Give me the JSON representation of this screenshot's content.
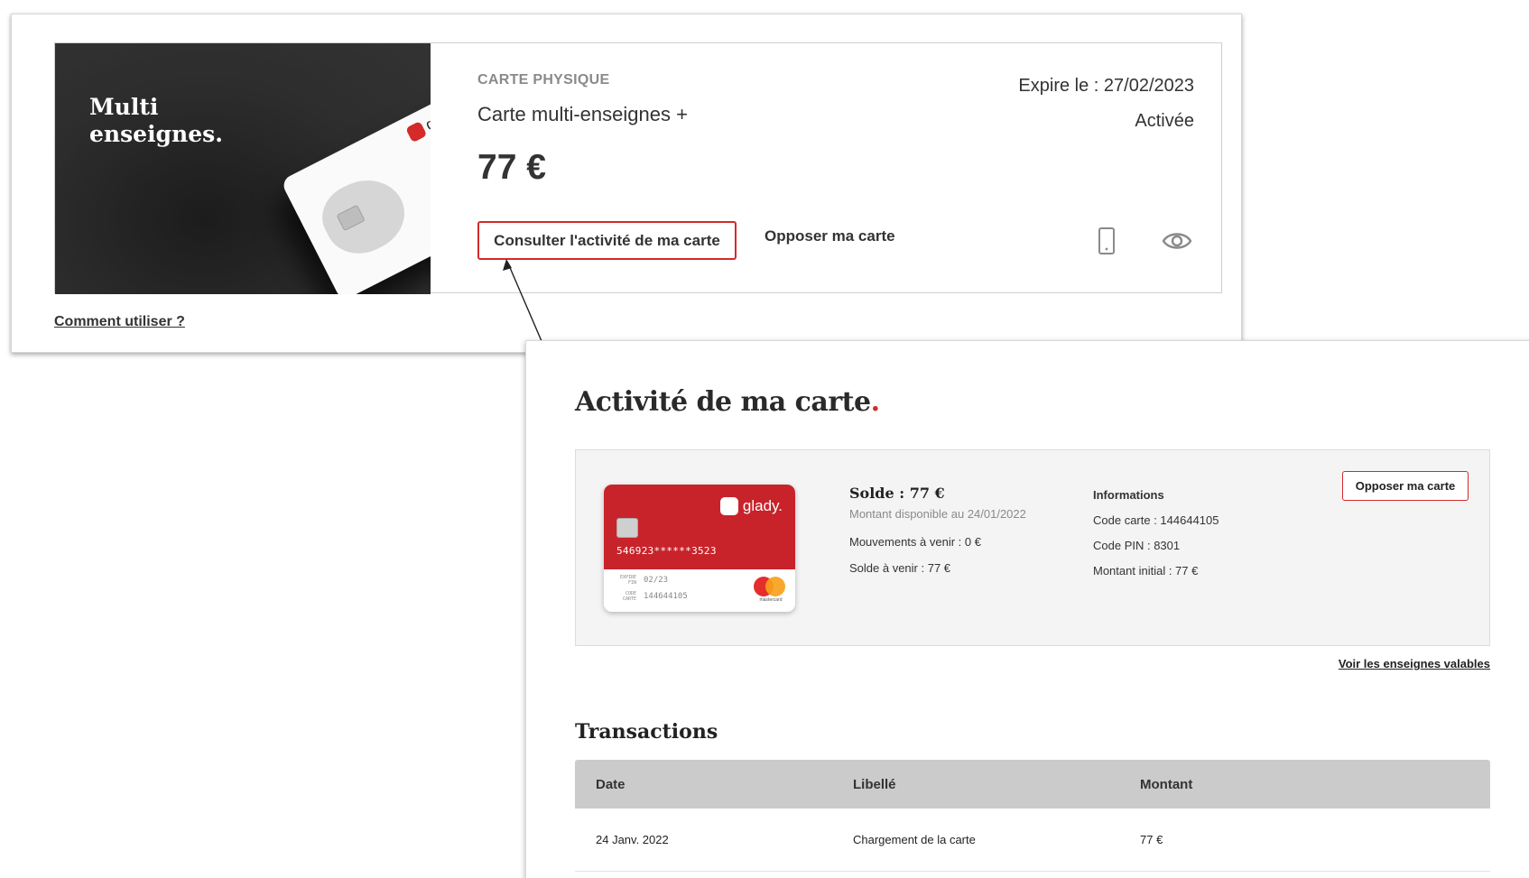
{
  "card_overview": {
    "promo_title_line1": "Multi",
    "promo_title_line2": "enseignes.",
    "promo_logo": "glady.",
    "card_type": "CARTE PHYSIQUE",
    "card_name": "Carte multi-enseignes +",
    "amount": "77 €",
    "expire": "Expire le : 27/02/2023",
    "status": "Activée",
    "activity_button": "Consulter l'activité de ma carte",
    "oppose_button": "Opposer ma carte",
    "icons": [
      "phone-icon",
      "eye-icon"
    ],
    "howto_link": "Comment utiliser ?"
  },
  "activity": {
    "title": "Activité de ma carte",
    "title_dot": ".",
    "virtual_card": {
      "logo": "glady.",
      "number": "546923******3523",
      "expire_label": "EXPIRE FIN",
      "expire_value": "02/23",
      "code_label": "CODE CARTE",
      "code_value": "144644105",
      "network": "mastercard"
    },
    "balance": {
      "title": "Solde : 77 €",
      "available": "Montant disponible au 24/01/2022",
      "upcoming_moves": "Mouvements à venir : 0 €",
      "upcoming_balance": "Solde à venir : 77 €"
    },
    "informations": {
      "title": "Informations",
      "card_code": "Code carte : 144644105",
      "pin_code": "Code PIN : 8301",
      "initial_amount": "Montant initial : 77 €"
    },
    "oppose_button": "Opposer ma carte",
    "valid_stores_link": "Voir les enseignes valables",
    "transactions": {
      "title": "Transactions",
      "headers": [
        "Date",
        "Libellé",
        "Montant"
      ],
      "rows": [
        [
          "24 Janv. 2022",
          "Chargement de la carte",
          "77 €"
        ]
      ]
    }
  },
  "colors": {
    "accent": "#d42a2a",
    "card_red": "#c8232a",
    "promo_bg": "#2d2d2d",
    "table_header": "#cbcbcb",
    "info_bg": "#f4f4f4"
  }
}
